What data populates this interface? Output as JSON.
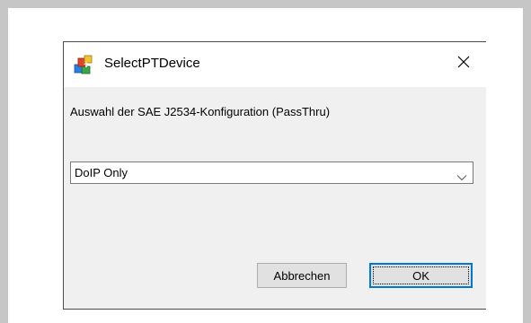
{
  "dialog": {
    "title": "SelectPTDevice",
    "icon": "app-package-icon",
    "close_icon": "close-icon"
  },
  "content": {
    "description": "Auswahl der SAE J2534-Konfiguration (PassThru)",
    "combo_selected": "DoIP Only",
    "combo_icon": "chevron-down-icon"
  },
  "buttons": {
    "cancel_label": "Abbrechen",
    "ok_label": "OK"
  },
  "colors": {
    "frame": "#c6c6c6",
    "dialog_body": "#f0f0f0",
    "button_bg": "#e1e1e1",
    "focus_accent": "#0078d7"
  }
}
